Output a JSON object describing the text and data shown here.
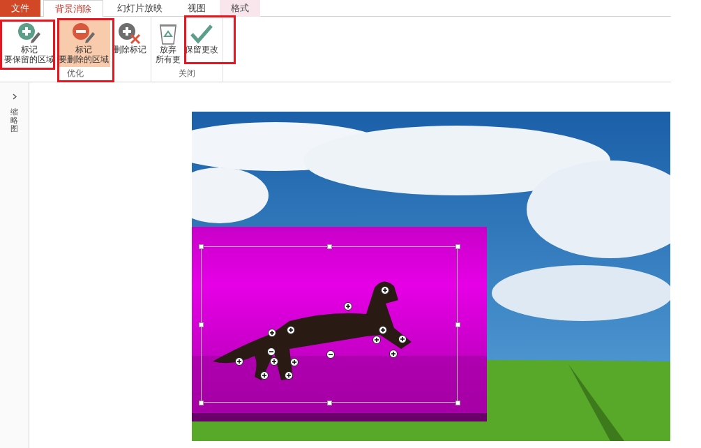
{
  "tabs": [
    {
      "label": "文件",
      "kind": "file",
      "selected": false
    },
    {
      "label": "背景消除",
      "kind": "tab",
      "selected": true
    },
    {
      "label": "幻灯片放映",
      "kind": "tab",
      "selected": false
    },
    {
      "label": "视图",
      "kind": "tab",
      "selected": false
    },
    {
      "label": "格式",
      "kind": "context",
      "selected": false
    }
  ],
  "ribbon_groups": [
    {
      "label": "优化",
      "buttons": [
        {
          "kind": "mark-keep",
          "lines": [
            "标记",
            "要保留的区域"
          ],
          "pressed": false
        },
        {
          "kind": "mark-remove",
          "lines": [
            "标记",
            "要删除的区域"
          ],
          "pressed": true
        },
        {
          "kind": "delete-mark",
          "lines": [
            "删除标记"
          ],
          "pressed": false
        }
      ]
    },
    {
      "label": "关闭",
      "buttons": [
        {
          "kind": "discard",
          "lines": [
            "放弃",
            "所有更"
          ],
          "pressed": false
        },
        {
          "kind": "keep-changes",
          "lines": [
            "保留更改"
          ],
          "pressed": false
        }
      ]
    }
  ],
  "thumbnail_pane": {
    "label": "缩略图",
    "expanded": false
  }
}
